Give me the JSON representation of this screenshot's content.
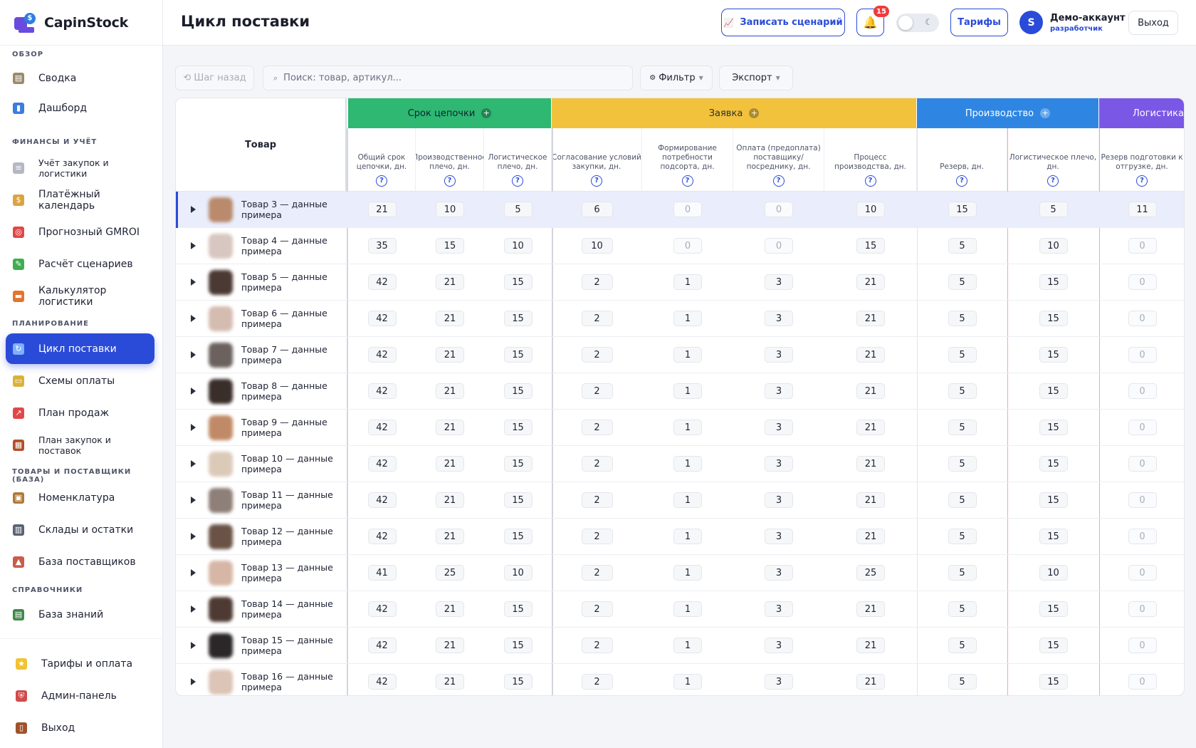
{
  "app": {
    "name": "CapinStock"
  },
  "sidebar": {
    "sections": [
      {
        "title": "ОБЗОР",
        "items": [
          {
            "label": "Сводка",
            "icon": "summary-icon",
            "color": "#9a8a6a"
          },
          {
            "label": "Дашборд",
            "icon": "chart-bar-icon",
            "color": "#3b7de0"
          }
        ]
      },
      {
        "title": "ФИНАНСЫ И УЧЁТ",
        "items": [
          {
            "label": "Учёт закупок и логистики",
            "icon": "receipt-icon",
            "color": "#b5b8c4",
            "small": true
          },
          {
            "label": "Платёжный календарь",
            "icon": "money-bag-icon",
            "color": "#d9a441"
          },
          {
            "label": "Прогнозный GMROI",
            "icon": "target-icon",
            "color": "#e04848"
          },
          {
            "label": "Расчёт сценариев",
            "icon": "pencil-icon",
            "color": "#3fae52"
          },
          {
            "label": "Калькулятор логистики",
            "icon": "truck-icon",
            "color": "#e5742c"
          }
        ]
      },
      {
        "title": "ПЛАНИРОВАНИЕ",
        "items": [
          {
            "label": "Цикл поставки",
            "icon": "cycle-icon",
            "color": "#7fb0ff",
            "active": true
          },
          {
            "label": "Схемы оплаты",
            "icon": "credit-card-icon",
            "color": "#d9b23a"
          },
          {
            "label": "План продаж",
            "icon": "trend-up-icon",
            "color": "#e04848"
          },
          {
            "label": "План закупок и поставок",
            "icon": "calendar-grid-icon",
            "color": "#b0502a",
            "small": true
          }
        ]
      },
      {
        "title": "ТОВАРЫ И ПОСТАВЩИКИ (БАЗА)",
        "items": [
          {
            "label": "Номенклатура",
            "icon": "package-icon",
            "color": "#b07a3a"
          },
          {
            "label": "Склады и остатки",
            "icon": "warehouse-icon",
            "color": "#5a6275"
          },
          {
            "label": "База поставщиков",
            "icon": "factory-icon",
            "color": "#c95c4a"
          }
        ]
      },
      {
        "title": "СПРАВОЧНИКИ",
        "items": [
          {
            "label": "База знаний",
            "icon": "books-icon",
            "color": "#3f8a4a"
          }
        ]
      }
    ],
    "bottom": [
      {
        "label": "Тарифы и оплата",
        "icon": "star-icon",
        "color": "#f1c232"
      },
      {
        "label": "Админ-панель",
        "icon": "shield-icon",
        "color": "#d44a4a"
      },
      {
        "label": "Выход",
        "icon": "door-icon",
        "color": "#a0522d"
      }
    ]
  },
  "header": {
    "title": "Цикл поставки",
    "record_label": "Записать сценарий",
    "notifications_count": "15",
    "tariffs_label": "Тарифы",
    "avatar_letter": "S",
    "account_name": "Демо-аккаунт",
    "account_role": "разработчик",
    "logout_label": "Выход"
  },
  "toolbar": {
    "back_label": "⟲ Шаг назад",
    "search_placeholder": "Поиск: товар, артикул...",
    "filter_label": "Фильтр",
    "export_label": "Экспорт"
  },
  "table": {
    "product_header": "Товар",
    "groups": [
      {
        "label": "Срок цепочки",
        "style": "g-green"
      },
      {
        "label": "Заявка",
        "style": "g-yellow"
      },
      {
        "label": "Производство",
        "style": "g-blue"
      },
      {
        "label": "Логистика до нашего склада / фул",
        "style": "g-purple"
      }
    ],
    "columns": [
      "Общий срок цепочки, дн.",
      "Производственное плечо, дн.",
      "Логистическое плечо, дн.",
      "Согласование условий закупки, дн.",
      "Формирование потребности подсорта, дн.",
      "Оплата (предоплата) поставщику/ посреднику, дн.",
      "Процесс производства, дн.",
      "Резерв, дн.",
      "Логистическое плечо, дн.",
      "Резерв подготовки к отгрузке, дн."
    ],
    "rows": [
      {
        "name": "Товар 3 — данные примера",
        "thumb": "#b98a6c",
        "selected": true,
        "values": [
          "21",
          "10",
          "5",
          "6",
          "0",
          "0",
          "10",
          "15",
          "5",
          "11"
        ]
      },
      {
        "name": "Товар 4 — данные примера",
        "thumb": "#d8c6c0",
        "values": [
          "35",
          "15",
          "10",
          "10",
          "0",
          "0",
          "15",
          "5",
          "10",
          "0"
        ]
      },
      {
        "name": "Товар 5 — данные примера",
        "thumb": "#4a3a33",
        "values": [
          "42",
          "21",
          "15",
          "2",
          "1",
          "3",
          "21",
          "5",
          "15",
          "0"
        ]
      },
      {
        "name": "Товар 6 — данные примера",
        "thumb": "#d5bcb0",
        "values": [
          "42",
          "21",
          "15",
          "2",
          "1",
          "3",
          "21",
          "5",
          "15",
          "0"
        ]
      },
      {
        "name": "Товар 7 — данные примера",
        "thumb": "#6b625f",
        "values": [
          "42",
          "21",
          "15",
          "2",
          "1",
          "3",
          "21",
          "5",
          "15",
          "0"
        ]
      },
      {
        "name": "Товар 8 — данные примера",
        "thumb": "#3a2e2a",
        "values": [
          "42",
          "21",
          "15",
          "2",
          "1",
          "3",
          "21",
          "5",
          "15",
          "0"
        ]
      },
      {
        "name": "Товар 9 — данные примера",
        "thumb": "#c08a66",
        "values": [
          "42",
          "21",
          "15",
          "2",
          "1",
          "3",
          "21",
          "5",
          "15",
          "0"
        ]
      },
      {
        "name": "Товар 10 — данные примера",
        "thumb": "#dccab9",
        "values": [
          "42",
          "21",
          "15",
          "2",
          "1",
          "3",
          "21",
          "5",
          "15",
          "0"
        ]
      },
      {
        "name": "Товар 11 — данные примера",
        "thumb": "#8e7f78",
        "values": [
          "42",
          "21",
          "15",
          "2",
          "1",
          "3",
          "21",
          "5",
          "15",
          "0"
        ]
      },
      {
        "name": "Товар 12 — данные примера",
        "thumb": "#6a5346",
        "values": [
          "42",
          "21",
          "15",
          "2",
          "1",
          "3",
          "21",
          "5",
          "15",
          "0"
        ]
      },
      {
        "name": "Товар 13 — данные примера",
        "thumb": "#d6b7a5",
        "values": [
          "41",
          "25",
          "10",
          "2",
          "1",
          "3",
          "25",
          "5",
          "10",
          "0"
        ]
      },
      {
        "name": "Товар 14 — данные примера",
        "thumb": "#4d3b33",
        "values": [
          "42",
          "21",
          "15",
          "2",
          "1",
          "3",
          "21",
          "5",
          "15",
          "0"
        ]
      },
      {
        "name": "Товар 15 — данные примера",
        "thumb": "#2b2728",
        "values": [
          "42",
          "21",
          "15",
          "2",
          "1",
          "3",
          "21",
          "5",
          "15",
          "0"
        ]
      },
      {
        "name": "Товар 16 — данные примера",
        "thumb": "#dcc4b6",
        "values": [
          "42",
          "21",
          "15",
          "2",
          "1",
          "3",
          "21",
          "5",
          "15",
          "0"
        ]
      }
    ]
  }
}
